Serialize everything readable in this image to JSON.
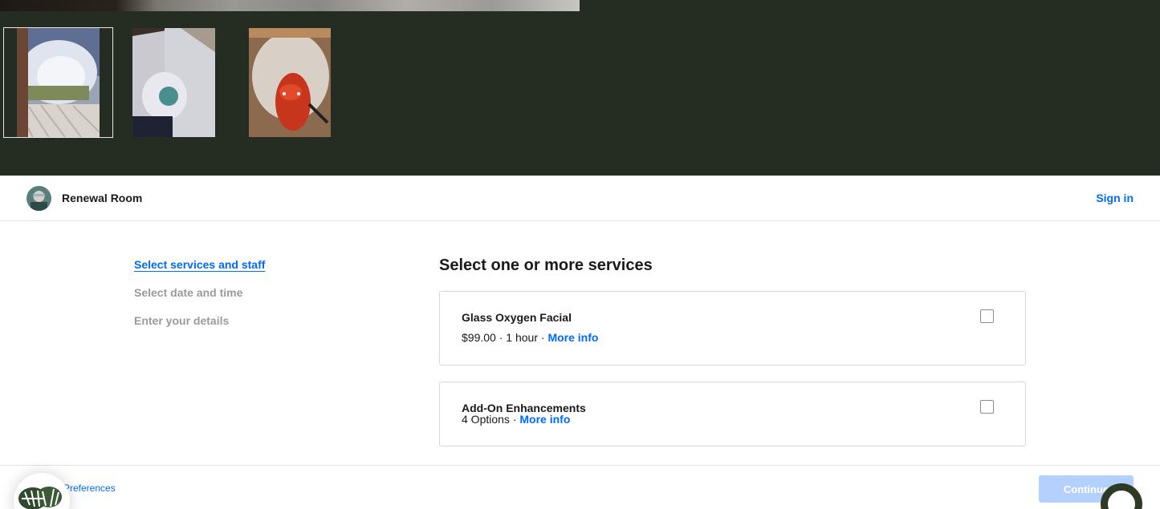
{
  "header": {
    "business_name": "Renewal Room",
    "sign_in_label": "Sign in"
  },
  "steps": [
    {
      "label": "Select services and staff",
      "active": true
    },
    {
      "label": "Select date and time",
      "active": false
    },
    {
      "label": "Enter your details",
      "active": false
    }
  ],
  "main": {
    "title": "Select one or more services",
    "services": [
      {
        "name": "Glass Oxygen Facial",
        "price": "$99.00",
        "duration": "1 hour",
        "more_info_label": "More info",
        "checked": false
      },
      {
        "name": "Add-On Enhancements",
        "options": "4 Options",
        "more_info_label": "More info",
        "checked": false
      }
    ]
  },
  "footer": {
    "preferences_label": "Preferences",
    "continue_label": "Continue"
  },
  "colors": {
    "gallery_bg": "#252d22",
    "accent": "#006aff",
    "continue_disabled": "#b3d1fc",
    "chat_ring": "#2f3a24"
  },
  "icons": [
    "business-avatar",
    "plant-icon",
    "chat-icon",
    "checkbox"
  ]
}
